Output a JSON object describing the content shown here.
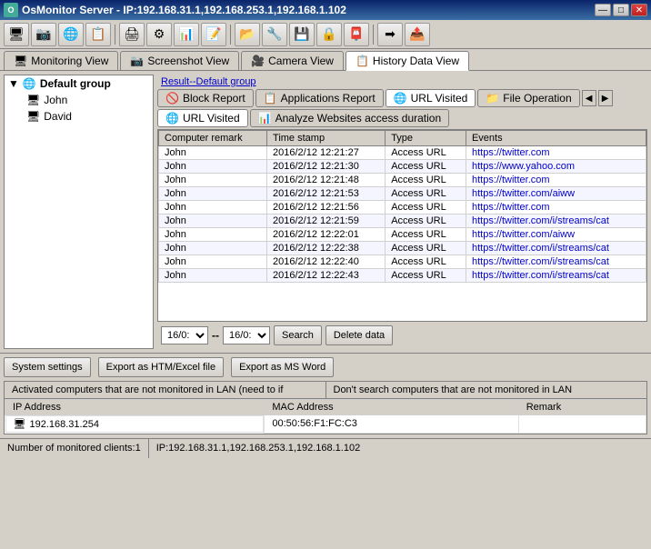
{
  "titleBar": {
    "title": "OsMonitor Server  -  IP:192.168.31.1,192.168.253.1,192.168.1.102",
    "minimize": "—",
    "maximize": "□",
    "close": "✕"
  },
  "toolbar": {
    "buttons": [
      "🖥",
      "📷",
      "🌐",
      "📋",
      "📁",
      "🖨",
      "⚙",
      "📊",
      "📝",
      "📂",
      "🔧",
      "💾",
      "🔒",
      "📮",
      "➡",
      "📤"
    ]
  },
  "navTabs": [
    {
      "id": "monitoring",
      "label": "Monitoring View",
      "icon": "🖥"
    },
    {
      "id": "screenshot",
      "label": "Screenshot View",
      "icon": "📷"
    },
    {
      "id": "camera",
      "label": "Camera View",
      "icon": "🎥"
    },
    {
      "id": "history",
      "label": "History Data View",
      "icon": "📋",
      "active": true
    }
  ],
  "sidebar": {
    "rootLabel": "Default group",
    "users": [
      "John",
      "David"
    ]
  },
  "resultLabel": "Result--Default group",
  "reportTabs": [
    {
      "id": "block",
      "label": "Block Report",
      "icon": "🚫",
      "active": false
    },
    {
      "id": "apps",
      "label": "Applications Report",
      "icon": "📋",
      "active": false
    },
    {
      "id": "url",
      "label": "URL Visited",
      "icon": "🌐",
      "active": true
    },
    {
      "id": "file",
      "label": "File Operation",
      "icon": "📁",
      "active": false
    }
  ],
  "subTabs": [
    {
      "id": "url-visited",
      "label": "URL Visited",
      "icon": "🌐",
      "active": true
    },
    {
      "id": "analyze",
      "label": "Analyze Websites access duration",
      "icon": "📊",
      "active": false
    }
  ],
  "tableHeaders": [
    "Computer remark",
    "Time stamp",
    "Type",
    "Events"
  ],
  "tableRows": [
    {
      "computer": "John",
      "time": "2016/2/12 12:21:27",
      "type": "Access URL",
      "event": "https://twitter.com"
    },
    {
      "computer": "John",
      "time": "2016/2/12 12:21:30",
      "type": "Access URL",
      "event": "https://www.yahoo.com"
    },
    {
      "computer": "John",
      "time": "2016/2/12 12:21:48",
      "type": "Access URL",
      "event": "https://twitter.com"
    },
    {
      "computer": "John",
      "time": "2016/2/12 12:21:53",
      "type": "Access URL",
      "event": "https://twitter.com/aiww"
    },
    {
      "computer": "John",
      "time": "2016/2/12 12:21:56",
      "type": "Access URL",
      "event": "https://twitter.com"
    },
    {
      "computer": "John",
      "time": "2016/2/12 12:21:59",
      "type": "Access URL",
      "event": "https://twitter.com/i/streams/cat"
    },
    {
      "computer": "John",
      "time": "2016/2/12 12:22:01",
      "type": "Access URL",
      "event": "https://twitter.com/aiww"
    },
    {
      "computer": "John",
      "time": "2016/2/12 12:22:38",
      "type": "Access URL",
      "event": "https://twitter.com/i/streams/cat"
    },
    {
      "computer": "John",
      "time": "2016/2/12 12:22:40",
      "type": "Access URL",
      "event": "https://twitter.com/i/streams/cat"
    },
    {
      "computer": "John",
      "time": "2016/2/12 12:22:43",
      "type": "Access URL",
      "event": "https://twitter.com/i/streams/cat"
    }
  ],
  "dateControls": {
    "from": "16/0:",
    "to": "16/0:",
    "searchLabel": "Search",
    "deleteLabel": "Delete data"
  },
  "bottomToolbar": {
    "systemSettings": "System settings",
    "exportHTM": "Export as HTM/Excel file",
    "exportWord": "Export as MS Word"
  },
  "lowerSection": {
    "headerLeft": "Activated computers that are not monitored in LAN (need to if",
    "headerRight": "Don't search computers that are not monitored in LAN",
    "columns": [
      "IP Address",
      "MAC Address",
      "Remark"
    ],
    "rows": [
      {
        "ip": "192.168.31.254",
        "mac": "00:50:56:F1:FC:C3",
        "remark": ""
      }
    ]
  },
  "statusBar": {
    "left": "Number of monitored clients:1",
    "right": "IP:192.168.31.1,192.168.253.1,192.168.1.102"
  }
}
